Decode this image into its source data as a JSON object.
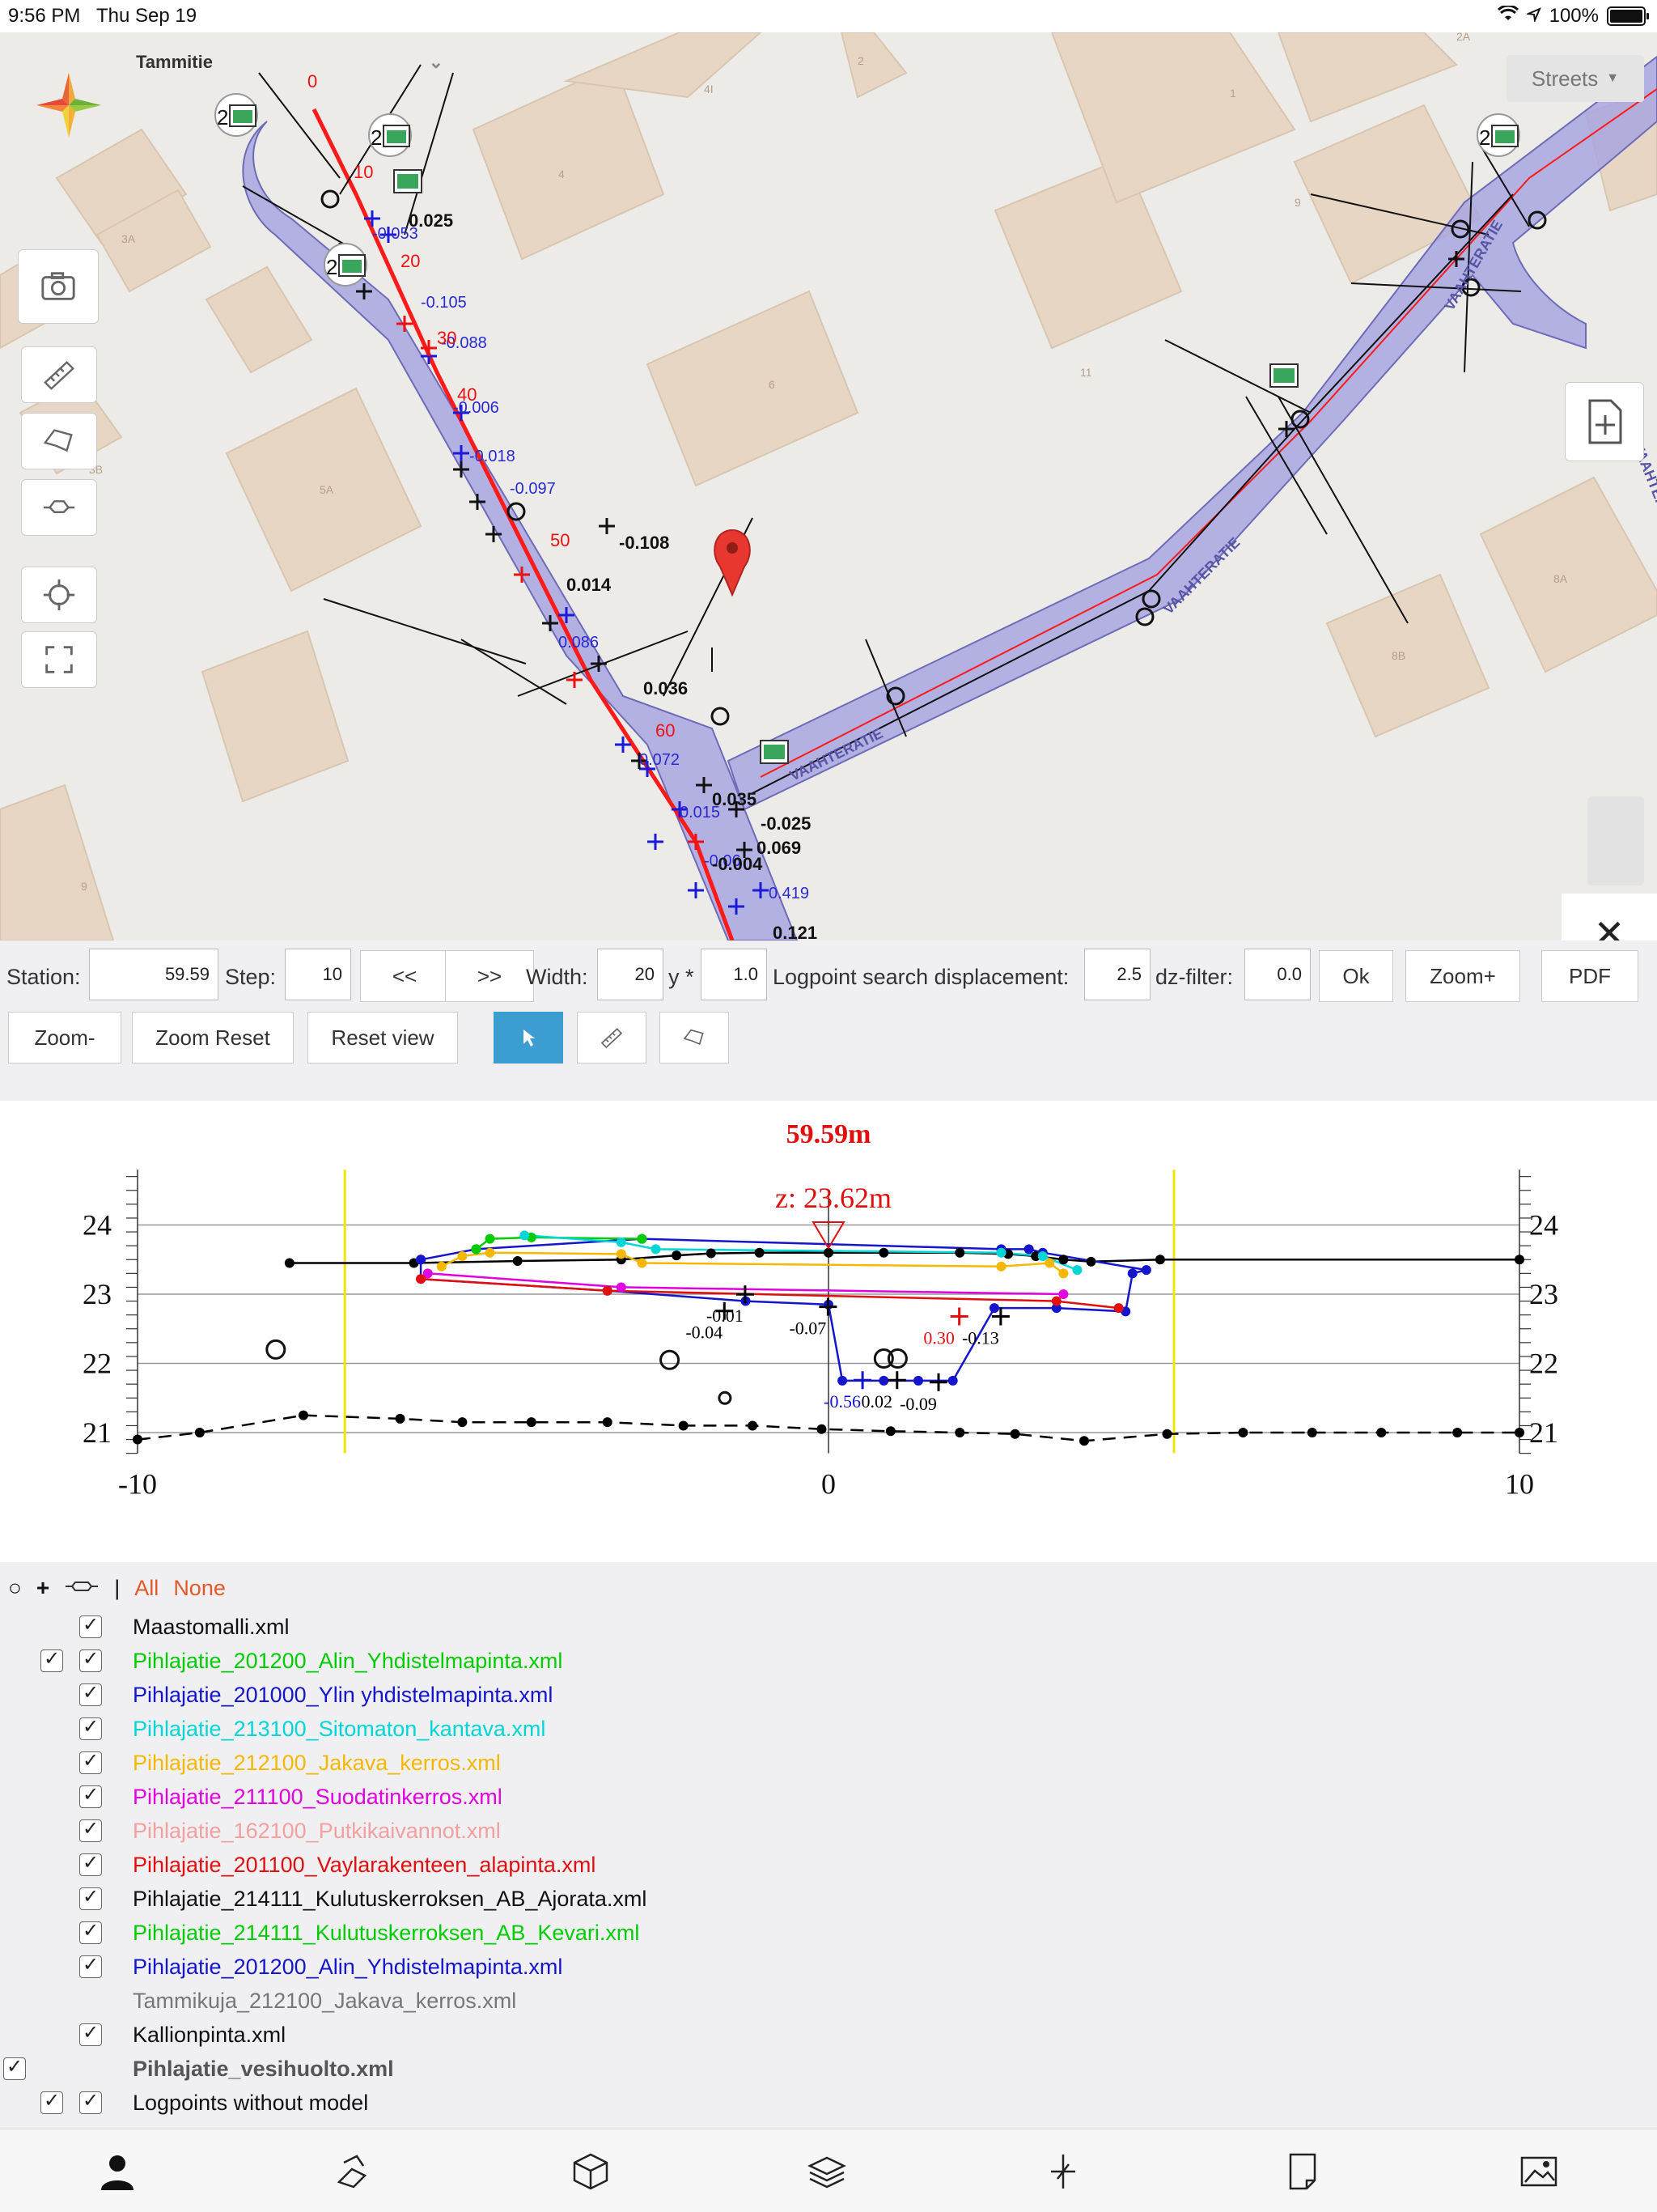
{
  "status_bar": {
    "time": "9:56 PM",
    "date": "Thu Sep 19",
    "battery": "100%"
  },
  "map": {
    "street_name": "Tammitie",
    "basemap_label": "Streets",
    "road_labels": [
      "VAAHTERATIE",
      "VAAHTERATIE",
      "VAAHTERATIE",
      "VAAHTERAKUJA"
    ],
    "station_marks": [
      "0",
      "10",
      "20",
      "30",
      "40",
      "50",
      "60"
    ],
    "photo_badges": [
      "2",
      "2",
      "2",
      "2"
    ],
    "building_numbers": [
      "3A",
      "3B",
      "5A",
      "4",
      "4I",
      "2",
      "6",
      "9",
      "11",
      "8A",
      "8B",
      "2A",
      "1",
      "9"
    ],
    "logpoint_values": [
      "0.025",
      "-0.108",
      "0.036",
      "-0.025",
      "0.069",
      "0.419",
      "0.121",
      "-0.004",
      "0.014",
      "0.035"
    ]
  },
  "controls": {
    "station_label": "Station:",
    "station_value": "59.59",
    "step_label": "Step:",
    "step_value": "10",
    "prev_btn": "<<",
    "next_btn": ">>",
    "width_label": "Width:",
    "width_value": "20",
    "width_mult": "y *",
    "width_factor": "1.0",
    "logpoint_label": "Logpoint search displacement:",
    "logpoint_value": "2.5",
    "dz_label": "dz-filter:",
    "dz_value": "0.0",
    "ok_btn": "Ok",
    "zoom_plus_btn": "Zoom+",
    "pdf_btn": "PDF",
    "zoom_minus_btn": "Zoom-",
    "zoom_reset_btn": "Zoom Reset",
    "reset_view_btn": "Reset view"
  },
  "chart_data": {
    "type": "line",
    "title": "59.59m",
    "annotation": "z:  23.62m",
    "xlim": [
      -10,
      10
    ],
    "ylim": [
      20.7,
      24.8
    ],
    "x_ticks": [
      -10,
      0,
      10
    ],
    "y_ticks": [
      21,
      22,
      23,
      24
    ],
    "vertical_markers": [
      -7,
      5
    ],
    "series": [
      {
        "name": "Maastomalli.xml",
        "color": "#000000",
        "dashed": false,
        "points": [
          [
            -7.8,
            23.45
          ],
          [
            -6,
            23.45
          ],
          [
            -4.5,
            23.48
          ],
          [
            -3,
            23.5
          ],
          [
            -2.2,
            23.56
          ],
          [
            -1.7,
            23.59
          ],
          [
            -1,
            23.6
          ],
          [
            0,
            23.6
          ],
          [
            0.8,
            23.6
          ],
          [
            1.9,
            23.6
          ],
          [
            2.6,
            23.58
          ],
          [
            3,
            23.55
          ],
          [
            3.4,
            23.5
          ],
          [
            3.8,
            23.47
          ],
          [
            4.8,
            23.5
          ],
          [
            10,
            23.5
          ]
        ]
      },
      {
        "name": "Kallionpinta.xml",
        "color": "#000000",
        "dashed": true,
        "points": [
          [
            -10,
            20.9
          ],
          [
            -9.1,
            21
          ],
          [
            -7.6,
            21.25
          ],
          [
            -6.2,
            21.2
          ],
          [
            -5.3,
            21.15
          ],
          [
            -4.3,
            21.15
          ],
          [
            -3.2,
            21.15
          ],
          [
            -2.1,
            21.1
          ],
          [
            -1.1,
            21.1
          ],
          [
            -0.1,
            21.05
          ],
          [
            0.9,
            21.02
          ],
          [
            1.9,
            21
          ],
          [
            2.7,
            20.98
          ],
          [
            3.7,
            20.88
          ],
          [
            4.9,
            20.98
          ],
          [
            6,
            21
          ],
          [
            7,
            21
          ],
          [
            8,
            21
          ],
          [
            9.1,
            21
          ],
          [
            10,
            21
          ]
        ]
      },
      {
        "name": "Pihlajatie_201200_Alin_Yhdistelmapinta.xml",
        "color": "#1515cc",
        "dashed": false,
        "points": [
          [
            -5.9,
            23.5
          ],
          [
            -5.9,
            23.22
          ],
          [
            -3.2,
            23.05
          ],
          [
            -1.2,
            22.9
          ],
          [
            0,
            22.85
          ],
          [
            0.2,
            21.75
          ],
          [
            0.8,
            21.75
          ],
          [
            1.3,
            21.75
          ],
          [
            1.8,
            21.75
          ],
          [
            2.4,
            22.8
          ],
          [
            3.3,
            22.8
          ],
          [
            4.3,
            22.75
          ],
          [
            4.4,
            23.3
          ],
          [
            4.6,
            23.35
          ],
          [
            3.1,
            23.6
          ],
          [
            2.9,
            23.65
          ],
          [
            2.5,
            23.65
          ],
          [
            -2.7,
            23.8
          ],
          [
            -5.1,
            23.65
          ],
          [
            -5.9,
            23.5
          ]
        ]
      },
      {
        "name": "Pihlajatie_201200_Alin_Yhdistelmapinta.xml (2)",
        "color": "#00cc00",
        "dashed": false,
        "points": [
          [
            -5.1,
            23.65
          ],
          [
            -4.9,
            23.8
          ],
          [
            -4.3,
            23.82
          ],
          [
            -2.7,
            23.8
          ]
        ]
      },
      {
        "name": "Pihlajatie_213100_Sitomaton_kantava.xml",
        "color": "#00d6d6",
        "dashed": false,
        "points": [
          [
            -4.4,
            23.85
          ],
          [
            -3,
            23.75
          ],
          [
            -2.5,
            23.65
          ],
          [
            2.5,
            23.6
          ],
          [
            3.1,
            23.55
          ],
          [
            3.6,
            23.35
          ]
        ]
      },
      {
        "name": "Pihlajatie_212100_Jakava_kerros.xml",
        "color": "#f5b800",
        "dashed": false,
        "points": [
          [
            -5.6,
            23.4
          ],
          [
            -5.3,
            23.55
          ],
          [
            -4.9,
            23.6
          ],
          [
            -3,
            23.58
          ],
          [
            -2.7,
            23.45
          ],
          [
            2.5,
            23.4
          ],
          [
            3.2,
            23.45
          ],
          [
            3.4,
            23.3
          ]
        ]
      },
      {
        "name": "Pihlajatie_211100_Suodatinkerros.xml",
        "color": "#e000e0",
        "dashed": false,
        "points": [
          [
            -5.8,
            23.3
          ],
          [
            -3,
            23.1
          ],
          [
            3.4,
            23
          ]
        ]
      },
      {
        "name": "Pihlajatie_201100_Vaylarakenteen_alapinta.xml",
        "color": "#e01010",
        "dashed": false,
        "points": [
          [
            -5.9,
            23.22
          ],
          [
            -3.2,
            23.05
          ],
          [
            3.3,
            22.9
          ],
          [
            4.2,
            22.8
          ]
        ]
      }
    ],
    "circles": [
      [
        -8,
        22.2
      ],
      [
        -2.3,
        22.05
      ],
      [
        -1.5,
        21.5
      ],
      [
        0.8,
        22.07
      ],
      [
        1,
        22.07
      ]
    ],
    "cross_labels": [
      {
        "x": -1.5,
        "y": 22.6,
        "text": "-0.01",
        "color": "#000000"
      },
      {
        "x": -1.8,
        "y": 22.36,
        "text": "-0.04",
        "color": "#000000"
      },
      {
        "x": -0.3,
        "y": 22.42,
        "text": "-0.07",
        "color": "#000000"
      },
      {
        "x": 1.6,
        "y": 22.28,
        "text": "0.30",
        "color": "#e01010"
      },
      {
        "x": 2.2,
        "y": 22.28,
        "text": "-0.13",
        "color": "#000000"
      },
      {
        "x": 0.2,
        "y": 21.36,
        "text": "-0.56",
        "color": "#1515cc"
      },
      {
        "x": 0.7,
        "y": 21.36,
        "text": "0.02",
        "color": "#000000"
      },
      {
        "x": 1.3,
        "y": 21.33,
        "text": "-0.09",
        "color": "#000000"
      }
    ]
  },
  "layers": {
    "header_all": "All",
    "header_none": "None",
    "header_sep": "|",
    "items": [
      {
        "name": "Maastomalli.xml",
        "color": "#111111",
        "checks": 1
      },
      {
        "name": "Pihlajatie_201200_Alin_Yhdistelmapinta.xml",
        "color": "#00cc00",
        "checks": 2
      },
      {
        "name": "Pihlajatie_201000_Ylin yhdistelmapinta.xml",
        "color": "#1515cc",
        "checks": 1
      },
      {
        "name": "Pihlajatie_213100_Sitomaton_kantava.xml",
        "color": "#00d6d6",
        "checks": 1
      },
      {
        "name": "Pihlajatie_212100_Jakava_kerros.xml",
        "color": "#f5b800",
        "checks": 1
      },
      {
        "name": "Pihlajatie_211100_Suodatinkerros.xml",
        "color": "#e000e0",
        "checks": 1
      },
      {
        "name": "Pihlajatie_162100_Putkikaivannot.xml",
        "color": "#f2a0a0",
        "checks": 1
      },
      {
        "name": "Pihlajatie_201100_Vaylarakenteen_alapinta.xml",
        "color": "#e01010",
        "checks": 1
      },
      {
        "name": "Pihlajatie_214111_Kulutuskerroksen_AB_Ajorata.xml",
        "color": "#111111",
        "checks": 1
      },
      {
        "name": "Pihlajatie_214111_Kulutuskerroksen_AB_Kevari.xml",
        "color": "#00cc00",
        "checks": 1
      },
      {
        "name": "Pihlajatie_201200_Alin_Yhdistelmapinta.xml",
        "color": "#1515cc",
        "checks": 1
      },
      {
        "name": "Tammikuja_212100_Jakava_kerros.xml",
        "color": "#777777",
        "checks": 0
      },
      {
        "name": "Kallionpinta.xml",
        "color": "#111111",
        "checks": 1
      },
      {
        "name": "Pihlajatie_vesihuolto.xml",
        "color": "#555555",
        "checks": 3
      },
      {
        "name": "Logpoints without model",
        "color": "#111111",
        "checks": 2
      }
    ]
  },
  "tabbar": {
    "icons": [
      "person-icon",
      "survey-icon",
      "cube-icon",
      "layers-icon",
      "crosshair-icon",
      "document-icon",
      "image-icon"
    ]
  }
}
